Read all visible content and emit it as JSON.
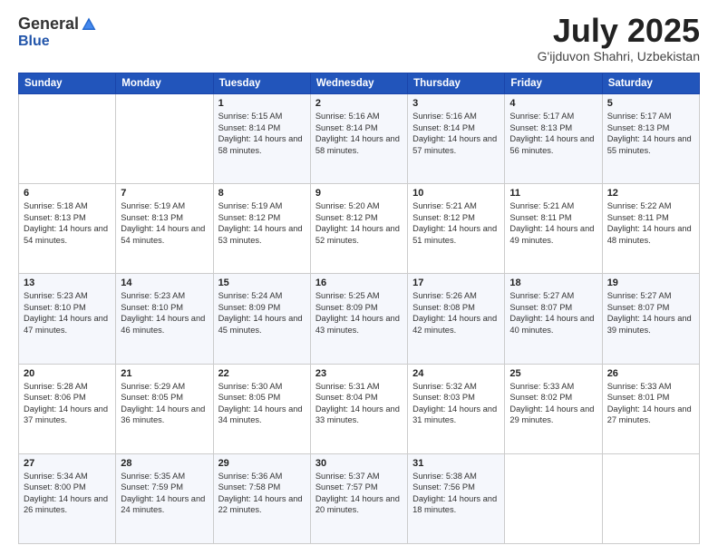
{
  "header": {
    "logo_general": "General",
    "logo_blue": "Blue",
    "month_title": "July 2025",
    "location": "G'ijduvon Shahri, Uzbekistan"
  },
  "calendar": {
    "days_of_week": [
      "Sunday",
      "Monday",
      "Tuesday",
      "Wednesday",
      "Thursday",
      "Friday",
      "Saturday"
    ],
    "weeks": [
      [
        {
          "day": "",
          "sunrise": "",
          "sunset": "",
          "daylight": ""
        },
        {
          "day": "",
          "sunrise": "",
          "sunset": "",
          "daylight": ""
        },
        {
          "day": "1",
          "sunrise": "Sunrise: 5:15 AM",
          "sunset": "Sunset: 8:14 PM",
          "daylight": "Daylight: 14 hours and 58 minutes."
        },
        {
          "day": "2",
          "sunrise": "Sunrise: 5:16 AM",
          "sunset": "Sunset: 8:14 PM",
          "daylight": "Daylight: 14 hours and 58 minutes."
        },
        {
          "day": "3",
          "sunrise": "Sunrise: 5:16 AM",
          "sunset": "Sunset: 8:14 PM",
          "daylight": "Daylight: 14 hours and 57 minutes."
        },
        {
          "day": "4",
          "sunrise": "Sunrise: 5:17 AM",
          "sunset": "Sunset: 8:13 PM",
          "daylight": "Daylight: 14 hours and 56 minutes."
        },
        {
          "day": "5",
          "sunrise": "Sunrise: 5:17 AM",
          "sunset": "Sunset: 8:13 PM",
          "daylight": "Daylight: 14 hours and 55 minutes."
        }
      ],
      [
        {
          "day": "6",
          "sunrise": "Sunrise: 5:18 AM",
          "sunset": "Sunset: 8:13 PM",
          "daylight": "Daylight: 14 hours and 54 minutes."
        },
        {
          "day": "7",
          "sunrise": "Sunrise: 5:19 AM",
          "sunset": "Sunset: 8:13 PM",
          "daylight": "Daylight: 14 hours and 54 minutes."
        },
        {
          "day": "8",
          "sunrise": "Sunrise: 5:19 AM",
          "sunset": "Sunset: 8:12 PM",
          "daylight": "Daylight: 14 hours and 53 minutes."
        },
        {
          "day": "9",
          "sunrise": "Sunrise: 5:20 AM",
          "sunset": "Sunset: 8:12 PM",
          "daylight": "Daylight: 14 hours and 52 minutes."
        },
        {
          "day": "10",
          "sunrise": "Sunrise: 5:21 AM",
          "sunset": "Sunset: 8:12 PM",
          "daylight": "Daylight: 14 hours and 51 minutes."
        },
        {
          "day": "11",
          "sunrise": "Sunrise: 5:21 AM",
          "sunset": "Sunset: 8:11 PM",
          "daylight": "Daylight: 14 hours and 49 minutes."
        },
        {
          "day": "12",
          "sunrise": "Sunrise: 5:22 AM",
          "sunset": "Sunset: 8:11 PM",
          "daylight": "Daylight: 14 hours and 48 minutes."
        }
      ],
      [
        {
          "day": "13",
          "sunrise": "Sunrise: 5:23 AM",
          "sunset": "Sunset: 8:10 PM",
          "daylight": "Daylight: 14 hours and 47 minutes."
        },
        {
          "day": "14",
          "sunrise": "Sunrise: 5:23 AM",
          "sunset": "Sunset: 8:10 PM",
          "daylight": "Daylight: 14 hours and 46 minutes."
        },
        {
          "day": "15",
          "sunrise": "Sunrise: 5:24 AM",
          "sunset": "Sunset: 8:09 PM",
          "daylight": "Daylight: 14 hours and 45 minutes."
        },
        {
          "day": "16",
          "sunrise": "Sunrise: 5:25 AM",
          "sunset": "Sunset: 8:09 PM",
          "daylight": "Daylight: 14 hours and 43 minutes."
        },
        {
          "day": "17",
          "sunrise": "Sunrise: 5:26 AM",
          "sunset": "Sunset: 8:08 PM",
          "daylight": "Daylight: 14 hours and 42 minutes."
        },
        {
          "day": "18",
          "sunrise": "Sunrise: 5:27 AM",
          "sunset": "Sunset: 8:07 PM",
          "daylight": "Daylight: 14 hours and 40 minutes."
        },
        {
          "day": "19",
          "sunrise": "Sunrise: 5:27 AM",
          "sunset": "Sunset: 8:07 PM",
          "daylight": "Daylight: 14 hours and 39 minutes."
        }
      ],
      [
        {
          "day": "20",
          "sunrise": "Sunrise: 5:28 AM",
          "sunset": "Sunset: 8:06 PM",
          "daylight": "Daylight: 14 hours and 37 minutes."
        },
        {
          "day": "21",
          "sunrise": "Sunrise: 5:29 AM",
          "sunset": "Sunset: 8:05 PM",
          "daylight": "Daylight: 14 hours and 36 minutes."
        },
        {
          "day": "22",
          "sunrise": "Sunrise: 5:30 AM",
          "sunset": "Sunset: 8:05 PM",
          "daylight": "Daylight: 14 hours and 34 minutes."
        },
        {
          "day": "23",
          "sunrise": "Sunrise: 5:31 AM",
          "sunset": "Sunset: 8:04 PM",
          "daylight": "Daylight: 14 hours and 33 minutes."
        },
        {
          "day": "24",
          "sunrise": "Sunrise: 5:32 AM",
          "sunset": "Sunset: 8:03 PM",
          "daylight": "Daylight: 14 hours and 31 minutes."
        },
        {
          "day": "25",
          "sunrise": "Sunrise: 5:33 AM",
          "sunset": "Sunset: 8:02 PM",
          "daylight": "Daylight: 14 hours and 29 minutes."
        },
        {
          "day": "26",
          "sunrise": "Sunrise: 5:33 AM",
          "sunset": "Sunset: 8:01 PM",
          "daylight": "Daylight: 14 hours and 27 minutes."
        }
      ],
      [
        {
          "day": "27",
          "sunrise": "Sunrise: 5:34 AM",
          "sunset": "Sunset: 8:00 PM",
          "daylight": "Daylight: 14 hours and 26 minutes."
        },
        {
          "day": "28",
          "sunrise": "Sunrise: 5:35 AM",
          "sunset": "Sunset: 7:59 PM",
          "daylight": "Daylight: 14 hours and 24 minutes."
        },
        {
          "day": "29",
          "sunrise": "Sunrise: 5:36 AM",
          "sunset": "Sunset: 7:58 PM",
          "daylight": "Daylight: 14 hours and 22 minutes."
        },
        {
          "day": "30",
          "sunrise": "Sunrise: 5:37 AM",
          "sunset": "Sunset: 7:57 PM",
          "daylight": "Daylight: 14 hours and 20 minutes."
        },
        {
          "day": "31",
          "sunrise": "Sunrise: 5:38 AM",
          "sunset": "Sunset: 7:56 PM",
          "daylight": "Daylight: 14 hours and 18 minutes."
        },
        {
          "day": "",
          "sunrise": "",
          "sunset": "",
          "daylight": ""
        },
        {
          "day": "",
          "sunrise": "",
          "sunset": "",
          "daylight": ""
        }
      ]
    ]
  }
}
